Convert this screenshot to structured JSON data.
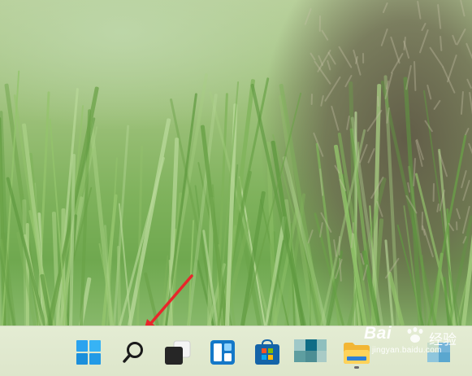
{
  "desktop": {
    "wallpaper": "grass-and-hedgehog-photo"
  },
  "taskbar": {
    "icons": [
      {
        "name": "windows-start-icon",
        "color": "#1e90e0"
      },
      {
        "name": "search-icon",
        "color": "#1a1a1a"
      },
      {
        "name": "task-view-icon",
        "color": "#1a1a1a"
      },
      {
        "name": "widgets-icon",
        "color": "#1478c8"
      },
      {
        "name": "microsoft-store-icon",
        "color": "#1464a8"
      },
      {
        "name": "file-explorer-icon",
        "color": "#f2b635"
      }
    ]
  },
  "annotation": {
    "arrow_color": "#e8262b",
    "points_to": "search-icon"
  },
  "watermark": {
    "brand": "Bai",
    "brand_suffix": "经验",
    "url": "jingyan.baidu.com"
  }
}
